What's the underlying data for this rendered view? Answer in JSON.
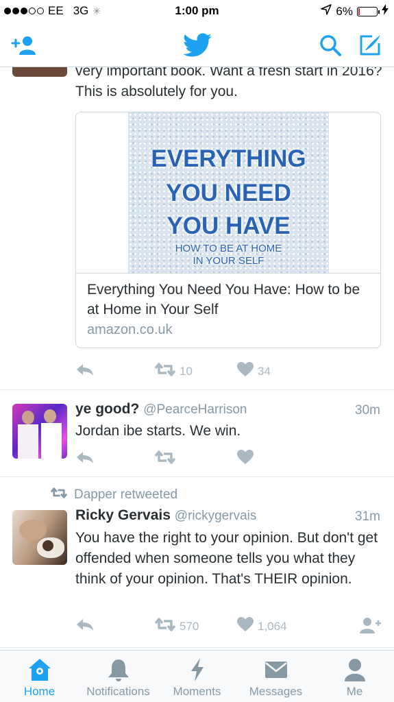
{
  "status_bar": {
    "carrier": "EE",
    "network": "3G",
    "time": "1:00 pm",
    "battery_percent": "6%",
    "battery_level": 0.06,
    "signal_bars": 3
  },
  "colors": {
    "brand": "#1da1f2",
    "icon_inactive": "#aab8c2",
    "secondary_text": "#8899a6",
    "battery_low": "#e0202a"
  },
  "nav": {
    "icons": [
      "add-user-icon",
      "twitter-bird-icon",
      "search-icon",
      "compose-icon"
    ]
  },
  "tweets": [
    {
      "text": "very important book. Want a fresh start in 2016? This is absolutely for you.",
      "card": {
        "image_lines": [
          "EVERYTHING",
          "YOU NEED",
          "YOU HAVE",
          "HOW TO BE AT HOME",
          "IN YOUR SELF"
        ],
        "title": "Everything You Need You Have: How to be at Home in Your Self",
        "domain": "amazon.co.uk"
      },
      "retweets": "10",
      "likes": "34"
    },
    {
      "name": "ye good?",
      "handle": "@PearceHarrison",
      "time": "30m",
      "text": "Jordan ibe starts. We win."
    },
    {
      "retweeted_by": "Dapper retweeted",
      "name": "Ricky Gervais",
      "handle": "@rickygervais",
      "time": "31m",
      "text": "You have the right to your opinion. But don't get offended when someone tells you what they think of your opinion. That's THEIR opinion.",
      "retweets": "570",
      "likes": "1,064"
    }
  ],
  "tabs": [
    {
      "label": "Home",
      "icon": "home-icon",
      "active": true
    },
    {
      "label": "Notifications",
      "icon": "bell-icon",
      "active": false
    },
    {
      "label": "Moments",
      "icon": "lightning-icon",
      "active": false
    },
    {
      "label": "Messages",
      "icon": "envelope-icon",
      "active": false
    },
    {
      "label": "Me",
      "icon": "person-icon",
      "active": false
    }
  ]
}
